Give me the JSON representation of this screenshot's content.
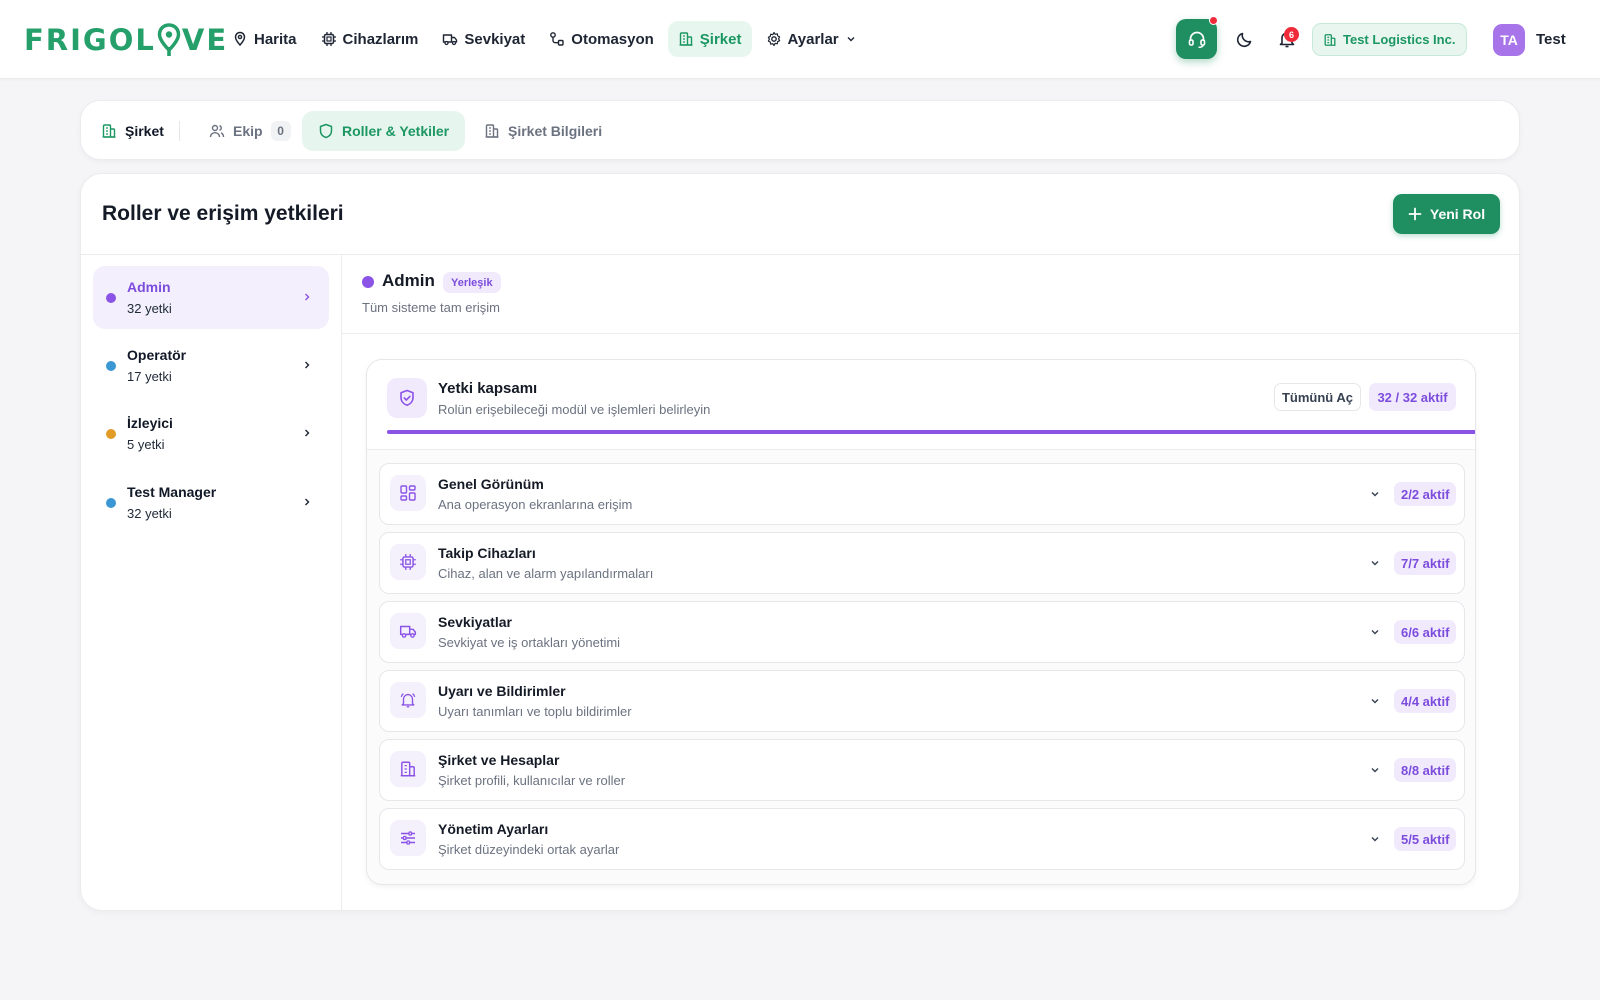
{
  "app": {
    "logo_text_before": "FRIGOL",
    "logo_text_after": "VE",
    "brand_color": "#26a06a"
  },
  "nav": {
    "items": [
      {
        "label": "Harita",
        "icon": "map-pin-icon"
      },
      {
        "label": "Cihazlarım",
        "icon": "chip-icon"
      },
      {
        "label": "Sevkiyat",
        "icon": "truck-icon"
      },
      {
        "label": "Otomasyon",
        "icon": "workflow-icon"
      },
      {
        "label": "Şirket",
        "icon": "building-icon",
        "active": true
      },
      {
        "label": "Ayarlar",
        "icon": "gear-icon"
      }
    ]
  },
  "header": {
    "notification_count": "6",
    "company_name": "Test Logistics Inc.",
    "avatar_initials": "TA",
    "user_name": "Test"
  },
  "subtabs": {
    "company": "Şirket",
    "team": "Ekip",
    "team_count": "0",
    "roles": "Roller & Yetkiler",
    "info": "Şirket Bilgileri"
  },
  "page": {
    "title": "Roller ve erişim yetkileri",
    "new_role_label": "Yeni Rol"
  },
  "roles": [
    {
      "name": "Admin",
      "count": "32 yetki",
      "color": "#8b53e6",
      "active": true
    },
    {
      "name": "Operatör",
      "count": "17 yetki",
      "color": "#3a97d4"
    },
    {
      "name": "İzleyici",
      "count": "5 yetki",
      "color": "#e29b26"
    },
    {
      "name": "Test Manager",
      "count": "32 yetki",
      "color": "#3a97d4"
    }
  ],
  "detail": {
    "name": "Admin",
    "badge": "Yerleşik",
    "description": "Tüm sisteme tam erişim",
    "color": "#8b53e6"
  },
  "scope": {
    "title": "Yetki kapsamı",
    "subtitle": "Rolün erişebileceği modül ve işlemleri belirleyin",
    "expand_all": "Tümünü Aç",
    "active_summary": "32 / 32 aktif",
    "progress_fraction": 1.0
  },
  "modules": [
    {
      "title": "Genel Görünüm",
      "desc": "Ana operasyon ekranlarına erişim",
      "count": "2/2 aktif",
      "icon": "layout-grid-icon"
    },
    {
      "title": "Takip Cihazları",
      "desc": "Cihaz, alan ve alarm yapılandırmaları",
      "count": "7/7 aktif",
      "icon": "chip-icon"
    },
    {
      "title": "Sevkiyatlar",
      "desc": "Sevkiyat ve iş ortakları yönetimi",
      "count": "6/6 aktif",
      "icon": "truck-icon"
    },
    {
      "title": "Uyarı ve Bildirimler",
      "desc": "Uyarı tanımları ve toplu bildirimler",
      "count": "4/4 aktif",
      "icon": "bell-ring-icon"
    },
    {
      "title": "Şirket ve Hesaplar",
      "desc": "Şirket profili, kullanıcılar ve roller",
      "count": "8/8 aktif",
      "icon": "building-icon"
    },
    {
      "title": "Yönetim Ayarları",
      "desc": "Şirket düzeyindeki ortak ayarlar",
      "count": "5/5 aktif",
      "icon": "sliders-icon"
    }
  ]
}
